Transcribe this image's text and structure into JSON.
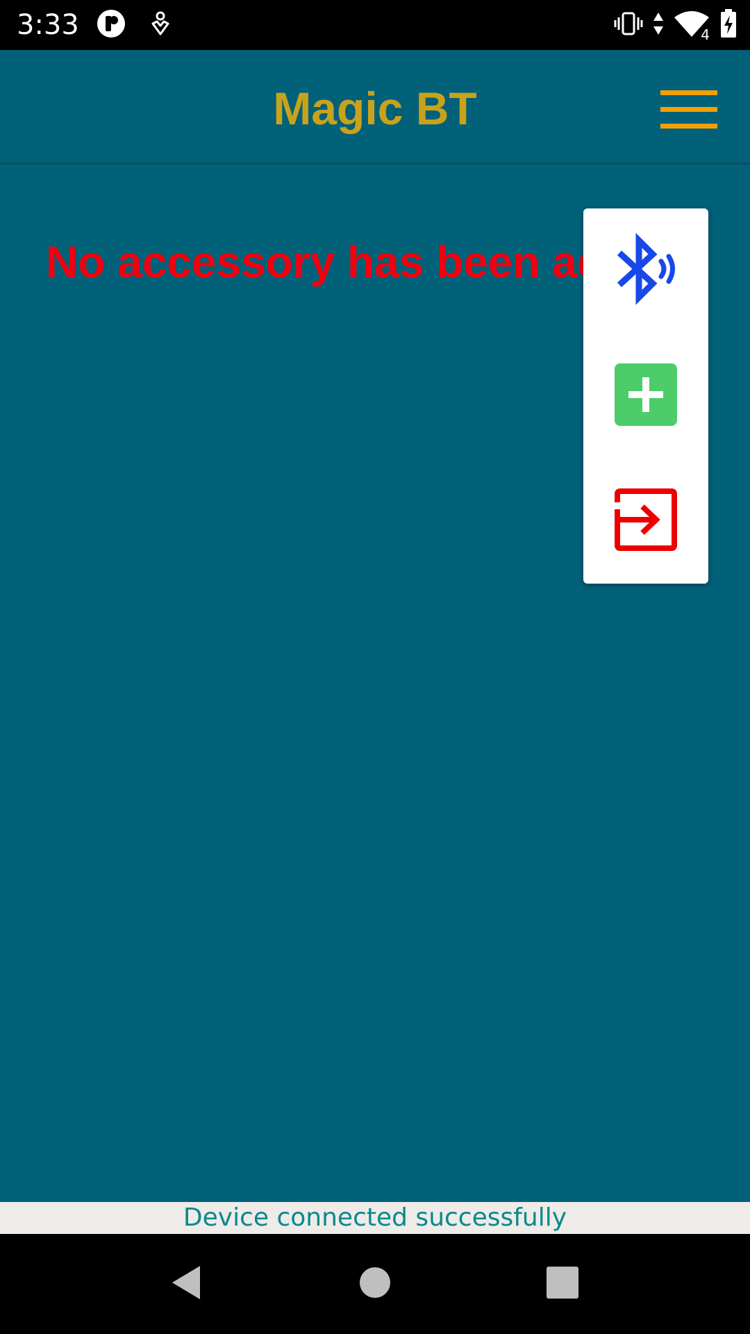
{
  "status_bar": {
    "time": "3:33",
    "icons": [
      "app-notification-icon",
      "location-shield-icon",
      "vibrate-icon",
      "data-arrows-icon",
      "wifi-icon",
      "battery-charging-icon"
    ],
    "wifi_badge": "4"
  },
  "app_bar": {
    "title": "Magic BT",
    "title_color": "#c9a21c",
    "menu_icon": "hamburger-menu-icon",
    "menu_color": "#f5a000"
  },
  "main": {
    "empty_message": "No accessory has been added",
    "message_color": "#f20010",
    "background_color": "#006179"
  },
  "popup_menu": {
    "items": [
      {
        "icon": "bluetooth-icon",
        "color": "#1848e8"
      },
      {
        "icon": "add-icon",
        "color": "#4ccd6a"
      },
      {
        "icon": "exit-icon",
        "color": "#ee0000"
      }
    ]
  },
  "toast": {
    "text": "Device connected successfully"
  },
  "nav_bar": {
    "buttons": [
      "back-icon",
      "home-icon",
      "recents-icon"
    ]
  }
}
